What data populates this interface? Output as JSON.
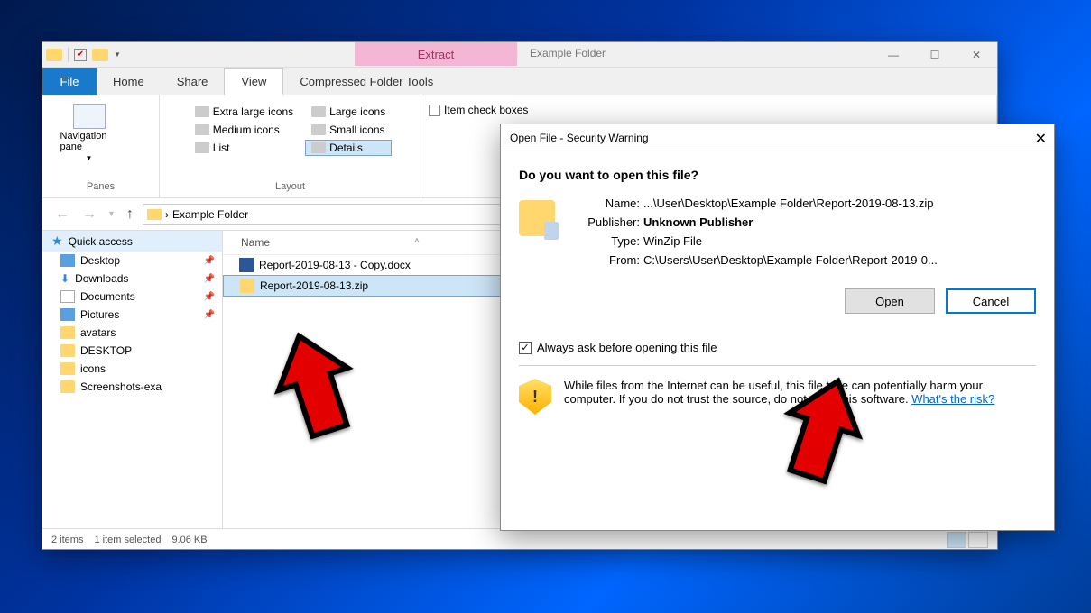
{
  "window": {
    "title": "Example Folder",
    "extract_label": "Extract",
    "tabs": {
      "file": "File",
      "home": "Home",
      "share": "Share",
      "view": "View",
      "compressed": "Compressed Folder Tools"
    }
  },
  "ribbon": {
    "panes_group": "Panes",
    "layout_group": "Layout",
    "nav_pane": "Navigation pane",
    "layout_items": [
      "Extra large icons",
      "Large icons",
      "Medium icons",
      "Small icons",
      "List",
      "Details"
    ],
    "item_check": "Item check boxes"
  },
  "address": {
    "folder": "Example Folder",
    "sep": "›"
  },
  "sidebar": {
    "quick_access": "Quick access",
    "items": [
      {
        "label": "Desktop",
        "pinned": true
      },
      {
        "label": "Downloads",
        "pinned": true
      },
      {
        "label": "Documents",
        "pinned": true
      },
      {
        "label": "Pictures",
        "pinned": true
      },
      {
        "label": "avatars",
        "pinned": false
      },
      {
        "label": "DESKTOP",
        "pinned": false
      },
      {
        "label": "icons",
        "pinned": false
      },
      {
        "label": "Screenshots-exa",
        "pinned": false
      }
    ]
  },
  "fileview": {
    "col_name": "Name",
    "rows": [
      {
        "name": "Report-2019-08-13 - Copy.docx",
        "type": "doc"
      },
      {
        "name": "Report-2019-08-13.zip",
        "type": "zip",
        "selected": true
      }
    ]
  },
  "status": {
    "count": "2 items",
    "selection": "1 item selected",
    "size": "9.06 KB"
  },
  "dialog": {
    "title": "Open File - Security Warning",
    "question": "Do you want to open this file?",
    "labels": {
      "name": "Name:",
      "publisher": "Publisher:",
      "type": "Type:",
      "from": "From:"
    },
    "values": {
      "name": "...\\User\\Desktop\\Example Folder\\Report-2019-08-13.zip",
      "publisher": "Unknown Publisher",
      "type": "WinZip File",
      "from": "C:\\Users\\User\\Desktop\\Example Folder\\Report-2019-0..."
    },
    "open": "Open",
    "cancel": "Cancel",
    "always_ask": "Always ask before opening this file",
    "warning_text": "While files from the Internet can be useful, this file type can potentially harm your computer. If you do not trust the source, do not open this software. ",
    "risk_link": "What's the risk?"
  },
  "winctrl": {
    "min": "—",
    "max": "☐",
    "close": "✕"
  }
}
